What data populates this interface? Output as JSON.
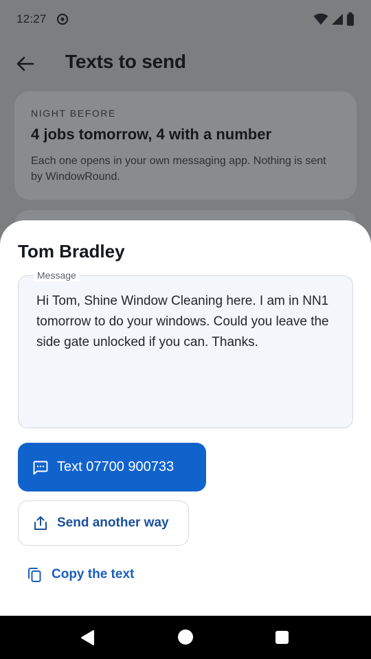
{
  "status_bar": {
    "time": "12:27"
  },
  "app_bar": {
    "title": "Texts to send"
  },
  "summary_card": {
    "kicker": "NIGHT BEFORE",
    "title": "4 jobs tomorrow, 4 with a number",
    "body": "Each one opens in your own messaging app. Nothing is sent by WindowRound."
  },
  "sheet": {
    "customer_name": "Tom Bradley",
    "message_label": "Message",
    "message_text": "Hi Tom, Shine Window Cleaning here. I am in NN1 tomorrow to do your windows. Could you leave the side gate unlocked if you can. Thanks.",
    "primary_label": "Text 07700 900733",
    "secondary_label": "Send another way",
    "copy_label": "Copy the text"
  },
  "colors": {
    "primary": "#1163cc",
    "link": "#1a5fbf",
    "scrim": "#7d7e80"
  }
}
